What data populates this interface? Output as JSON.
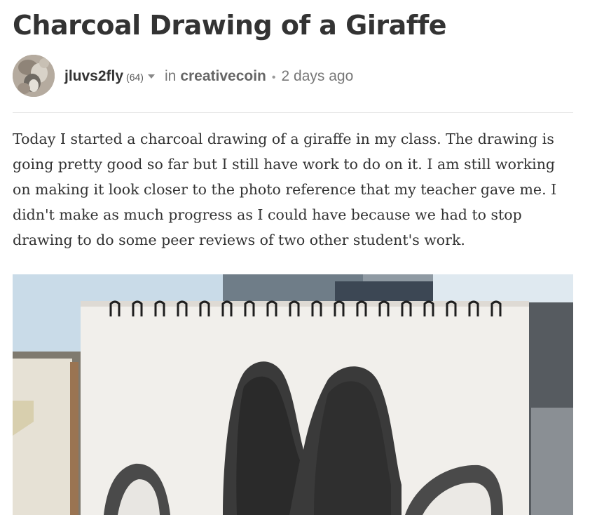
{
  "post": {
    "title": "Charcoal Drawing of a Giraffe",
    "author": "jluvs2fly",
    "reputation": "(64)",
    "in_label": "in",
    "community": "creativecoin",
    "separator": "•",
    "time": "2 days ago",
    "body": "Today I started a charcoal drawing of a giraffe in my class. The drawing is going pretty good so far but I still have work to do on it. I am still working on making it look closer to the photo reference that my teacher gave me. I didn't make as much progress as I could have because we had to stop drawing to do some peer reviews of two other student's work."
  },
  "icons": {
    "author_menu": "chevron-down-icon"
  },
  "colors": {
    "title": "#333333",
    "meta": "#777777",
    "divider": "#e6e6e6"
  }
}
